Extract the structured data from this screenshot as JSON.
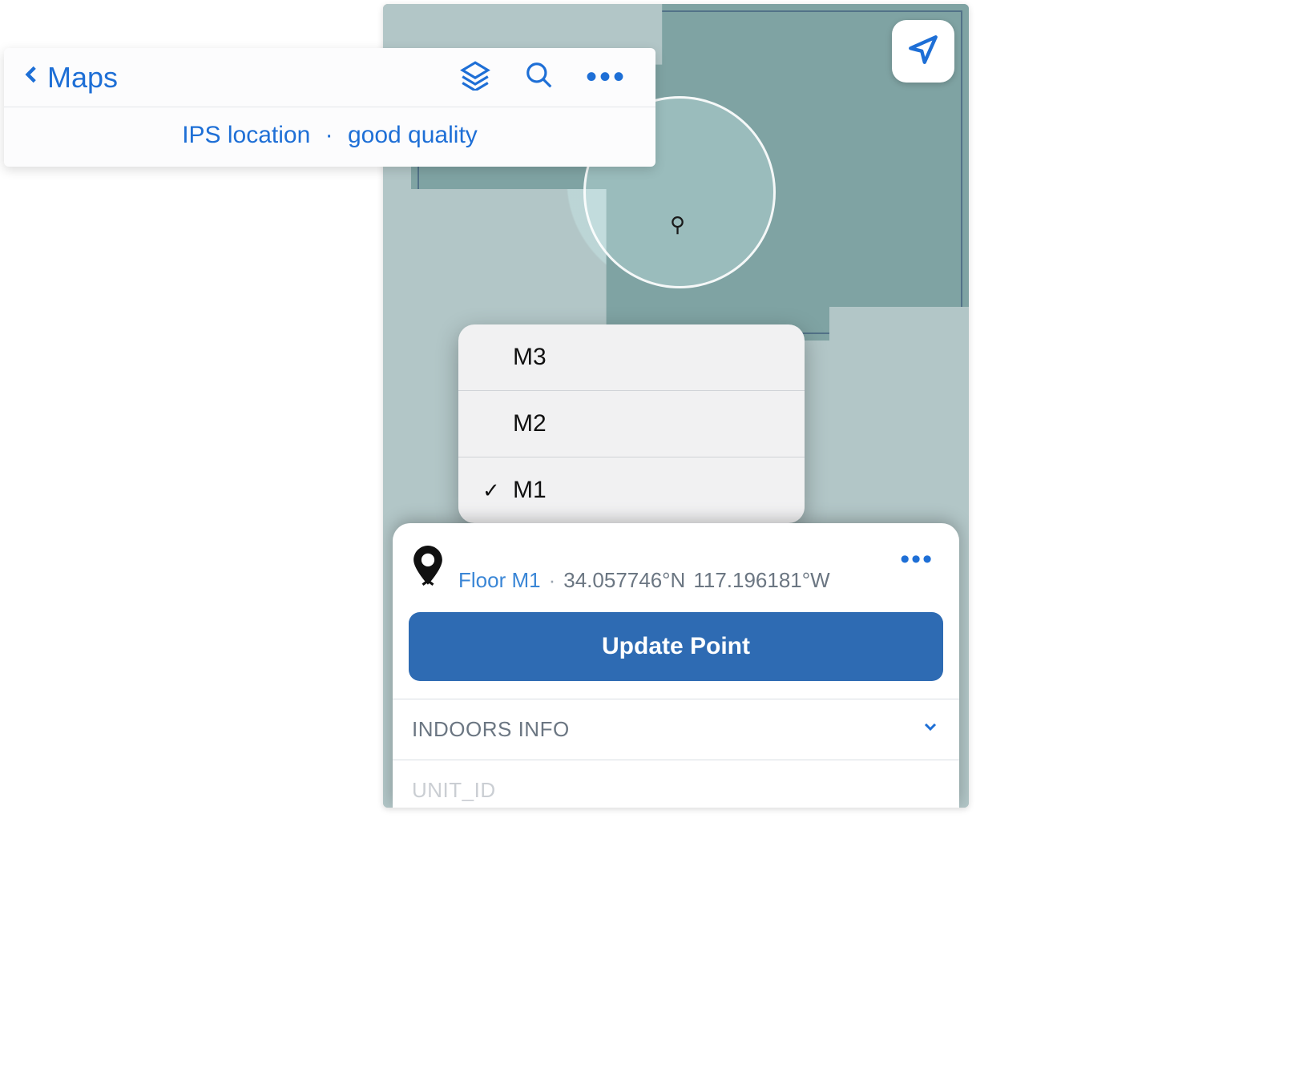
{
  "header": {
    "back_label": "Maps",
    "status_primary": "IPS location",
    "status_secondary": "good quality"
  },
  "floor_picker": {
    "options": [
      "M3",
      "M2",
      "M1"
    ],
    "selected": "M1"
  },
  "point_card": {
    "floor_label": "Floor M1",
    "latitude": "34.057746°N",
    "longitude": "117.196181°W",
    "update_button": "Update Point",
    "section_indoors": "INDOORS INFO",
    "section_unit_partial": "UNIT_ID"
  },
  "colors": {
    "accent": "#1e6fd6",
    "button": "#2e6bb3"
  }
}
